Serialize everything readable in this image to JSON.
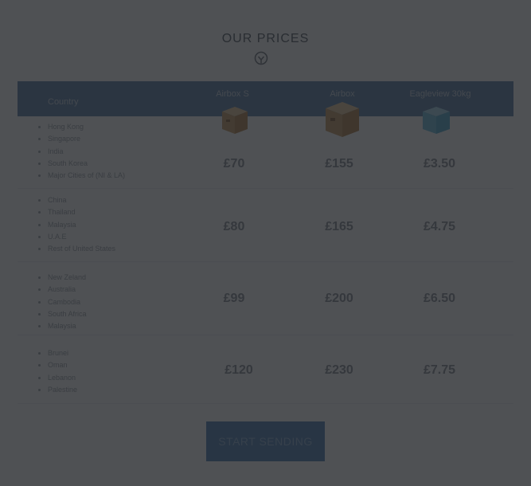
{
  "heading": {
    "title": "OUR PRICES"
  },
  "table": {
    "header": {
      "country_label": "Country",
      "columns": [
        "Airbox S",
        "Airbox",
        "Eagleview 30kg"
      ]
    },
    "rows": [
      {
        "countries": [
          "Hong Kong",
          "Singapore",
          "India",
          "South Korea",
          "Major Cities of (NI & LA)"
        ],
        "prices": [
          "£70",
          "£155",
          "£3.50"
        ]
      },
      {
        "countries": [
          "China",
          "Thailand",
          "Malaysia",
          "U.A.E",
          "Rest of United States"
        ],
        "prices": [
          "£80",
          "£165",
          "£4.75"
        ]
      },
      {
        "countries": [
          "New Zeland",
          "Australia",
          "Cambodia",
          "South Africa",
          "Malaysia"
        ],
        "prices": [
          "£99",
          "£200",
          "£6.50"
        ]
      },
      {
        "countries": [
          "Brunei",
          "Oman",
          "Lebanon",
          "Palestine"
        ],
        "prices": [
          "£120",
          "£230",
          "£7.75"
        ]
      }
    ]
  },
  "cta": {
    "label": "START SENDING"
  },
  "colors": {
    "header": "#5b7fa8",
    "button": "#4e7fb5",
    "overlay": "#1e2024"
  },
  "icons": {
    "heading": "chevron-circle-down-icon",
    "box_small": "cardboard-box-icon",
    "box_large": "cardboard-box-icon",
    "box_blue": "blue-box-icon"
  }
}
